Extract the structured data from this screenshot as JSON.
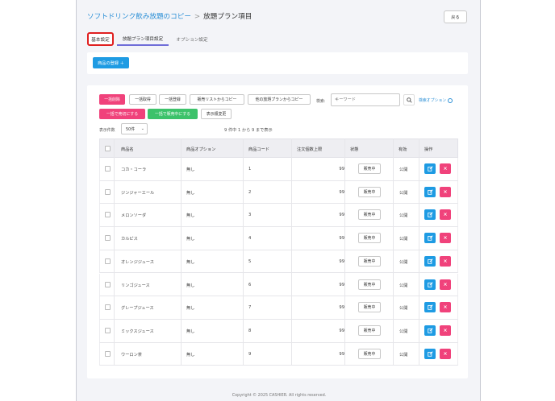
{
  "breadcrumb": {
    "parent": "ソフトドリンク飲み放題のコピー",
    "separator": ">",
    "current": "放題プラン項目"
  },
  "back_label": "戻る",
  "tabs": [
    {
      "label": "基本設定"
    },
    {
      "label": "放題プラン項目設定"
    },
    {
      "label": "オプション設定"
    }
  ],
  "register_label": "商品の登録 ＋",
  "toolbar": {
    "bulk_delete": "一括削除",
    "bulk_get": "一括取得",
    "bulk_register": "一括登録",
    "copy_from_sales": "販売リストからコピー",
    "copy_from_other": "他の放題プランからコピー",
    "bulk_soldout": "一括で売切にする",
    "bulk_onsale": "一括で販売中にする",
    "order_change": "表示順変更"
  },
  "search": {
    "label": "検索:",
    "placeholder": "キーワード",
    "options_label": "検索オプション"
  },
  "page_size": {
    "label": "表示件数",
    "value": "50件"
  },
  "info": "9 件中 1 から 9 まで表示",
  "columns": [
    "商品名",
    "商品オプション",
    "商品コード",
    "注文個数上限",
    "状態",
    "有効",
    "操作"
  ],
  "rows": [
    {
      "name": "コカ・コーラ",
      "option": "無し",
      "code": "1",
      "limit": "99",
      "status": "販売中",
      "active": "公開"
    },
    {
      "name": "ジンジャーエール",
      "option": "無し",
      "code": "2",
      "limit": "99",
      "status": "販売中",
      "active": "公開"
    },
    {
      "name": "メロンソーダ",
      "option": "無し",
      "code": "3",
      "limit": "99",
      "status": "販売中",
      "active": "公開"
    },
    {
      "name": "カルピス",
      "option": "無し",
      "code": "4",
      "limit": "99",
      "status": "販売中",
      "active": "公開"
    },
    {
      "name": "オレンジジュース",
      "option": "無し",
      "code": "5",
      "limit": "99",
      "status": "販売中",
      "active": "公開"
    },
    {
      "name": "リンゴジュース",
      "option": "無し",
      "code": "6",
      "limit": "99",
      "status": "販売中",
      "active": "公開"
    },
    {
      "name": "グレープジュース",
      "option": "無し",
      "code": "7",
      "limit": "99",
      "status": "販売中",
      "active": "公開"
    },
    {
      "name": "ミックスジュース",
      "option": "無し",
      "code": "8",
      "limit": "99",
      "status": "販売中",
      "active": "公開"
    },
    {
      "name": "ウーロン茶",
      "option": "無し",
      "code": "9",
      "limit": "99",
      "status": "販売中",
      "active": "公開"
    }
  ],
  "row_icons": {
    "edit": "edit-icon",
    "delete": "delete-icon"
  },
  "colors": {
    "accent": "#1e9be3",
    "danger": "#f0427b",
    "success": "#3cc26a",
    "highlight": "#e02020"
  },
  "footer": "Copyright © 2025 CASHIER. All rights reserved."
}
